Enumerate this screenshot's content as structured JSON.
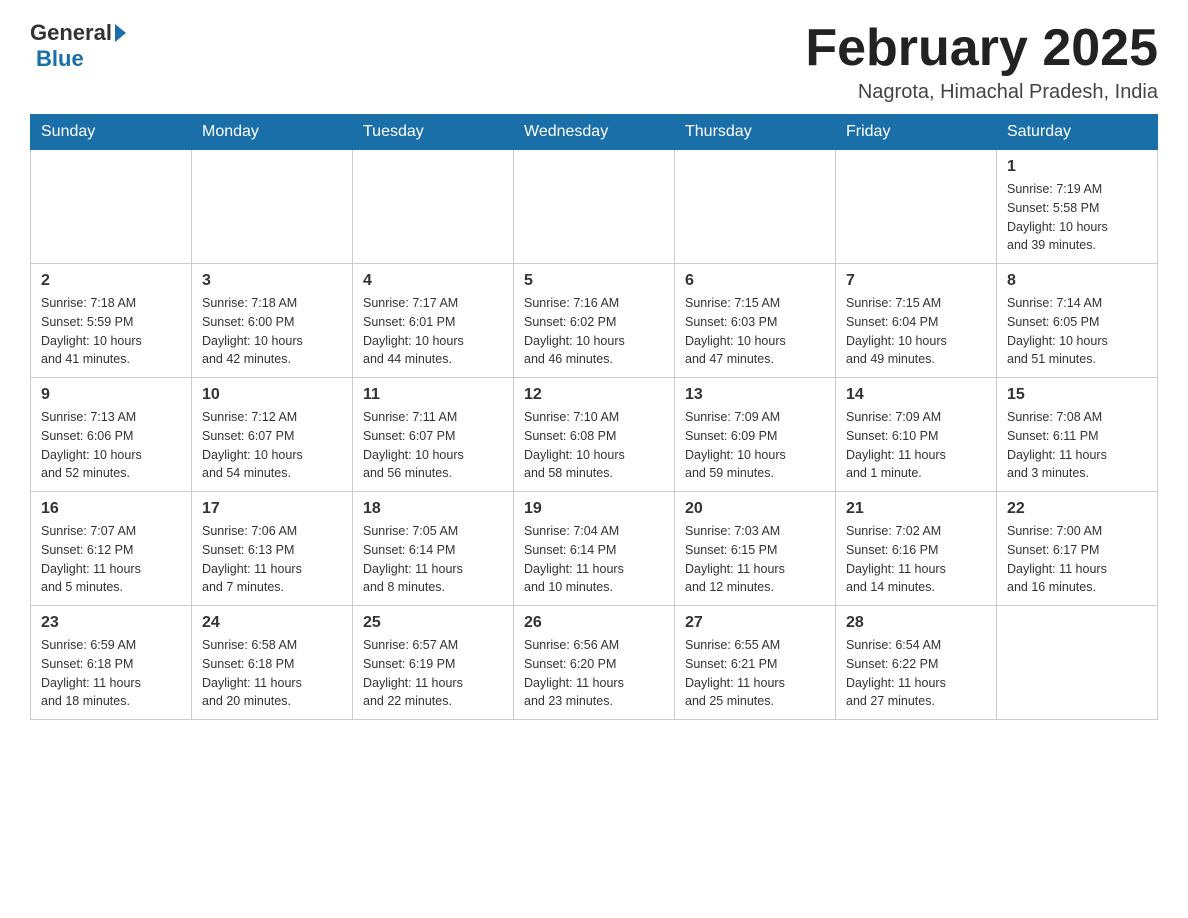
{
  "header": {
    "logo_general": "General",
    "logo_blue": "Blue",
    "month_title": "February 2025",
    "location": "Nagrota, Himachal Pradesh, India"
  },
  "days_of_week": [
    "Sunday",
    "Monday",
    "Tuesday",
    "Wednesday",
    "Thursday",
    "Friday",
    "Saturday"
  ],
  "weeks": [
    [
      {
        "day": "",
        "info": ""
      },
      {
        "day": "",
        "info": ""
      },
      {
        "day": "",
        "info": ""
      },
      {
        "day": "",
        "info": ""
      },
      {
        "day": "",
        "info": ""
      },
      {
        "day": "",
        "info": ""
      },
      {
        "day": "1",
        "info": "Sunrise: 7:19 AM\nSunset: 5:58 PM\nDaylight: 10 hours\nand 39 minutes."
      }
    ],
    [
      {
        "day": "2",
        "info": "Sunrise: 7:18 AM\nSunset: 5:59 PM\nDaylight: 10 hours\nand 41 minutes."
      },
      {
        "day": "3",
        "info": "Sunrise: 7:18 AM\nSunset: 6:00 PM\nDaylight: 10 hours\nand 42 minutes."
      },
      {
        "day": "4",
        "info": "Sunrise: 7:17 AM\nSunset: 6:01 PM\nDaylight: 10 hours\nand 44 minutes."
      },
      {
        "day": "5",
        "info": "Sunrise: 7:16 AM\nSunset: 6:02 PM\nDaylight: 10 hours\nand 46 minutes."
      },
      {
        "day": "6",
        "info": "Sunrise: 7:15 AM\nSunset: 6:03 PM\nDaylight: 10 hours\nand 47 minutes."
      },
      {
        "day": "7",
        "info": "Sunrise: 7:15 AM\nSunset: 6:04 PM\nDaylight: 10 hours\nand 49 minutes."
      },
      {
        "day": "8",
        "info": "Sunrise: 7:14 AM\nSunset: 6:05 PM\nDaylight: 10 hours\nand 51 minutes."
      }
    ],
    [
      {
        "day": "9",
        "info": "Sunrise: 7:13 AM\nSunset: 6:06 PM\nDaylight: 10 hours\nand 52 minutes."
      },
      {
        "day": "10",
        "info": "Sunrise: 7:12 AM\nSunset: 6:07 PM\nDaylight: 10 hours\nand 54 minutes."
      },
      {
        "day": "11",
        "info": "Sunrise: 7:11 AM\nSunset: 6:07 PM\nDaylight: 10 hours\nand 56 minutes."
      },
      {
        "day": "12",
        "info": "Sunrise: 7:10 AM\nSunset: 6:08 PM\nDaylight: 10 hours\nand 58 minutes."
      },
      {
        "day": "13",
        "info": "Sunrise: 7:09 AM\nSunset: 6:09 PM\nDaylight: 10 hours\nand 59 minutes."
      },
      {
        "day": "14",
        "info": "Sunrise: 7:09 AM\nSunset: 6:10 PM\nDaylight: 11 hours\nand 1 minute."
      },
      {
        "day": "15",
        "info": "Sunrise: 7:08 AM\nSunset: 6:11 PM\nDaylight: 11 hours\nand 3 minutes."
      }
    ],
    [
      {
        "day": "16",
        "info": "Sunrise: 7:07 AM\nSunset: 6:12 PM\nDaylight: 11 hours\nand 5 minutes."
      },
      {
        "day": "17",
        "info": "Sunrise: 7:06 AM\nSunset: 6:13 PM\nDaylight: 11 hours\nand 7 minutes."
      },
      {
        "day": "18",
        "info": "Sunrise: 7:05 AM\nSunset: 6:14 PM\nDaylight: 11 hours\nand 8 minutes."
      },
      {
        "day": "19",
        "info": "Sunrise: 7:04 AM\nSunset: 6:14 PM\nDaylight: 11 hours\nand 10 minutes."
      },
      {
        "day": "20",
        "info": "Sunrise: 7:03 AM\nSunset: 6:15 PM\nDaylight: 11 hours\nand 12 minutes."
      },
      {
        "day": "21",
        "info": "Sunrise: 7:02 AM\nSunset: 6:16 PM\nDaylight: 11 hours\nand 14 minutes."
      },
      {
        "day": "22",
        "info": "Sunrise: 7:00 AM\nSunset: 6:17 PM\nDaylight: 11 hours\nand 16 minutes."
      }
    ],
    [
      {
        "day": "23",
        "info": "Sunrise: 6:59 AM\nSunset: 6:18 PM\nDaylight: 11 hours\nand 18 minutes."
      },
      {
        "day": "24",
        "info": "Sunrise: 6:58 AM\nSunset: 6:18 PM\nDaylight: 11 hours\nand 20 minutes."
      },
      {
        "day": "25",
        "info": "Sunrise: 6:57 AM\nSunset: 6:19 PM\nDaylight: 11 hours\nand 22 minutes."
      },
      {
        "day": "26",
        "info": "Sunrise: 6:56 AM\nSunset: 6:20 PM\nDaylight: 11 hours\nand 23 minutes."
      },
      {
        "day": "27",
        "info": "Sunrise: 6:55 AM\nSunset: 6:21 PM\nDaylight: 11 hours\nand 25 minutes."
      },
      {
        "day": "28",
        "info": "Sunrise: 6:54 AM\nSunset: 6:22 PM\nDaylight: 11 hours\nand 27 minutes."
      },
      {
        "day": "",
        "info": ""
      }
    ]
  ]
}
